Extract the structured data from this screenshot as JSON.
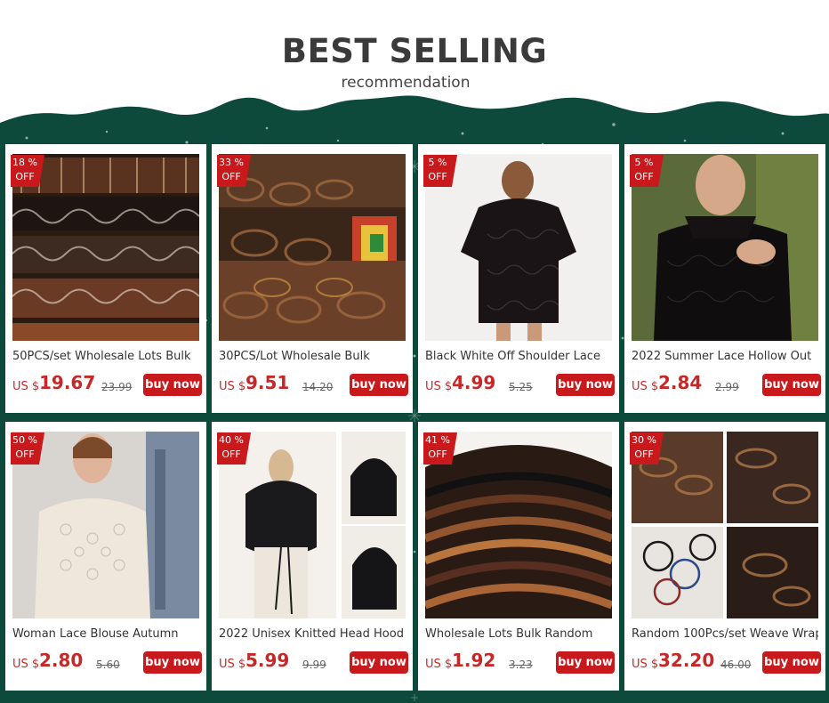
{
  "header": {
    "title": "BEST SELLING",
    "subtitle": "recommendation"
  },
  "colors": {
    "background": "#0d4a3c",
    "accent": "#c8191c",
    "price": "#c62828",
    "badge": "#c8191c"
  },
  "products": [
    {
      "name": "50PCS/set Wholesale Lots Bulk",
      "discount": "18 %",
      "off": "OFF",
      "currency": "US $",
      "price": "19.67",
      "old_price": "23.99",
      "button": "buy now",
      "image": "leather-bracelets-stack"
    },
    {
      "name": "30PCS/Lot Wholesale Bulk",
      "discount": "33 %",
      "off": "OFF",
      "currency": "US $",
      "price": "9.51",
      "old_price": "14.20",
      "button": "buy now",
      "image": "bracelets-pile"
    },
    {
      "name": "Black White Off Shoulder Lace",
      "discount": "5 %",
      "off": "OFF",
      "currency": "US $",
      "price": "4.99",
      "old_price": "5.25",
      "button": "buy now",
      "image": "black-lace-dress"
    },
    {
      "name": "2022 Summer Lace Hollow Out",
      "discount": "5 %",
      "off": "OFF",
      "currency": "US $",
      "price": "2.84",
      "old_price": "2.99",
      "button": "buy now",
      "image": "black-lace-top"
    },
    {
      "name": "Woman Lace Blouse Autumn",
      "discount": "50 %",
      "off": "OFF",
      "currency": "US $",
      "price": "2.80",
      "old_price": "5.60",
      "button": "buy now",
      "image": "white-lace-blouse"
    },
    {
      "name": "2022 Unisex Knitted Head Hood",
      "discount": "40 %",
      "off": "OFF",
      "currency": "US $",
      "price": "5.99",
      "old_price": "9.99",
      "button": "buy now",
      "image": "knitted-hood"
    },
    {
      "name": "Wholesale Lots Bulk Random",
      "discount": "41 %",
      "off": "OFF",
      "currency": "US $",
      "price": "1.92",
      "old_price": "3.23",
      "button": "buy now",
      "image": "braided-bracelets"
    },
    {
      "name": "Random 100Pcs/set Weave Wrap",
      "discount": "30 %",
      "off": "OFF",
      "currency": "US $",
      "price": "32.20",
      "old_price": "46.00",
      "button": "buy now",
      "image": "bracelet-collage"
    }
  ]
}
